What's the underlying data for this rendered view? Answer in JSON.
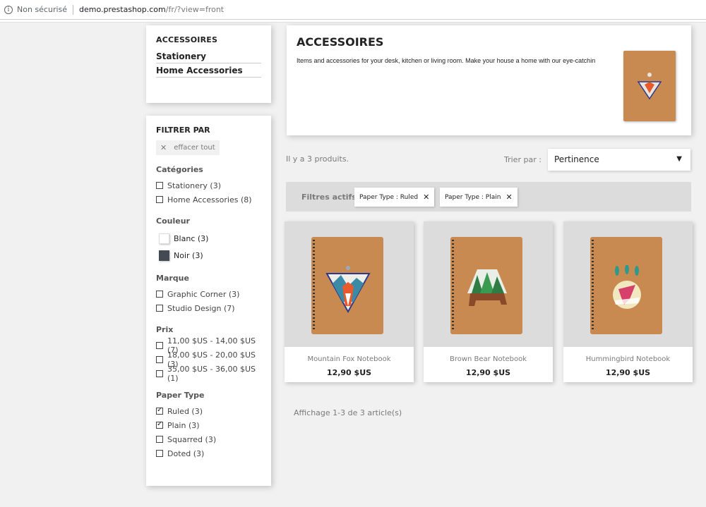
{
  "browser": {
    "security_label": "Non sécurisé",
    "url_host": "demo.prestashop.com",
    "url_path": "/fr/?view=front"
  },
  "category_nav": {
    "title": "ACCESSOIRES",
    "items": [
      "Stationery",
      "Home Accessories"
    ]
  },
  "filters": {
    "title": "FILTRER PAR",
    "clear_all": "effacer tout",
    "categories": {
      "title": "Catégories",
      "options": [
        {
          "label": "Stationery (3)",
          "checked": false
        },
        {
          "label": "Home Accessories (8)",
          "checked": false
        }
      ]
    },
    "color": {
      "title": "Couleur",
      "options": [
        {
          "label": "Blanc (3)",
          "swatch": "#ffffff"
        },
        {
          "label": "Noir (3)",
          "swatch": "#434a54"
        }
      ]
    },
    "brand": {
      "title": "Marque",
      "options": [
        {
          "label": "Graphic Corner (3)",
          "checked": false
        },
        {
          "label": "Studio Design (7)",
          "checked": false
        }
      ]
    },
    "price": {
      "title": "Prix",
      "options": [
        {
          "label": "11,00 $US - 14,00 $US (7)",
          "checked": false
        },
        {
          "label": "18,00 $US - 20,00 $US (3)",
          "checked": false
        },
        {
          "label": "35,00 $US - 36,00 $US (1)",
          "checked": false
        }
      ]
    },
    "paper_type": {
      "title": "Paper Type",
      "options": [
        {
          "label": "Ruled (3)",
          "checked": true
        },
        {
          "label": "Plain (3)",
          "checked": true
        },
        {
          "label": "Squarred (3)",
          "checked": false
        },
        {
          "label": "Doted (3)",
          "checked": false
        }
      ]
    }
  },
  "header": {
    "title": "ACCESSOIRES",
    "description": "Items and accessories for your desk, kitchen or living room. Make your house a home with our eye-catchin"
  },
  "listing": {
    "count_text": "Il y a 3 produits.",
    "sort_label": "Trier par :",
    "sort_value": "Pertinence",
    "active_filters_title": "Filtres actifs",
    "active_filters": [
      "Paper Type : Ruled",
      "Paper Type : Plain"
    ],
    "products": [
      {
        "name": "Mountain Fox Notebook",
        "price": "12,90 $US"
      },
      {
        "name": "Brown Bear Notebook",
        "price": "12,90 $US"
      },
      {
        "name": "Hummingbird Notebook",
        "price": "12,90 $US"
      }
    ],
    "pagination_text": "Affichage 1-3 de 3 article(s)"
  }
}
